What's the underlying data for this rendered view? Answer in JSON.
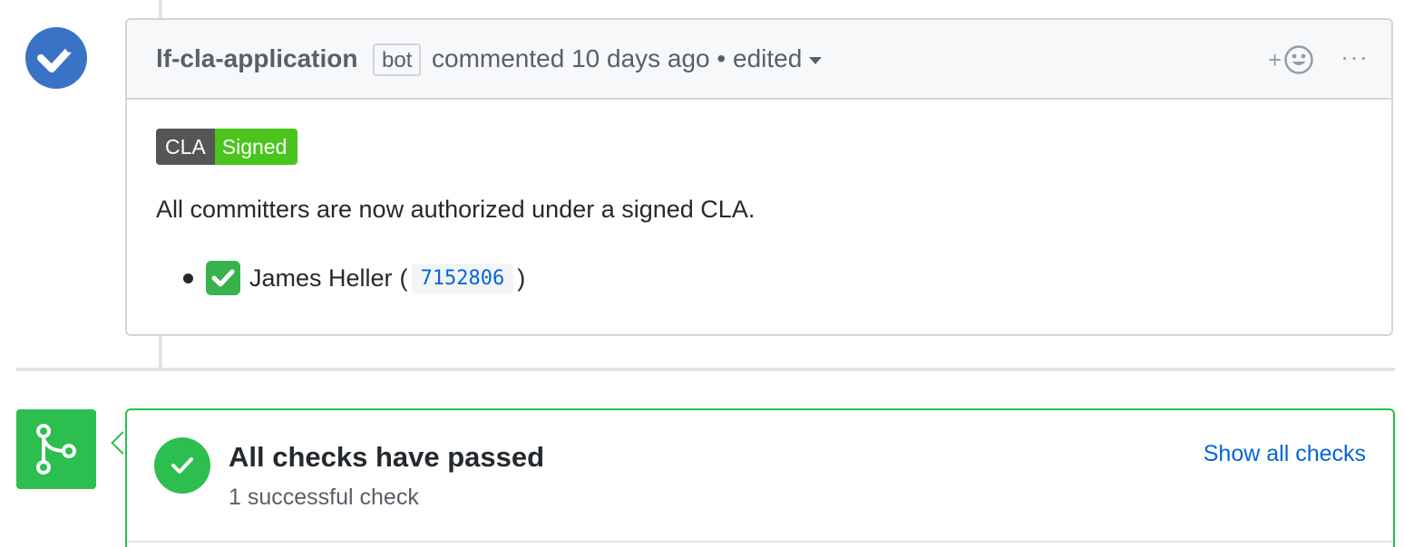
{
  "comment": {
    "author": "lf-cla-application",
    "author_label": "bot",
    "meta": "commented 10 days ago • edited",
    "reaction_plus": "+",
    "more": "···",
    "badge": {
      "left": "CLA",
      "right": "Signed"
    },
    "body_text": "All committers are now authorized under a signed CLA.",
    "committer": {
      "name": "James Heller",
      "open_paren": "(",
      "commit": "7152806",
      "close_paren": ")"
    }
  },
  "checks": {
    "title": "All checks have passed",
    "subtitle": "1 successful check",
    "show_all": "Show all checks"
  },
  "colors": {
    "avatar": "#3a73c6",
    "success": "#2cbe4e",
    "badge_dark": "#555555",
    "badge_green": "#4bc51d",
    "link": "#0366d6"
  }
}
